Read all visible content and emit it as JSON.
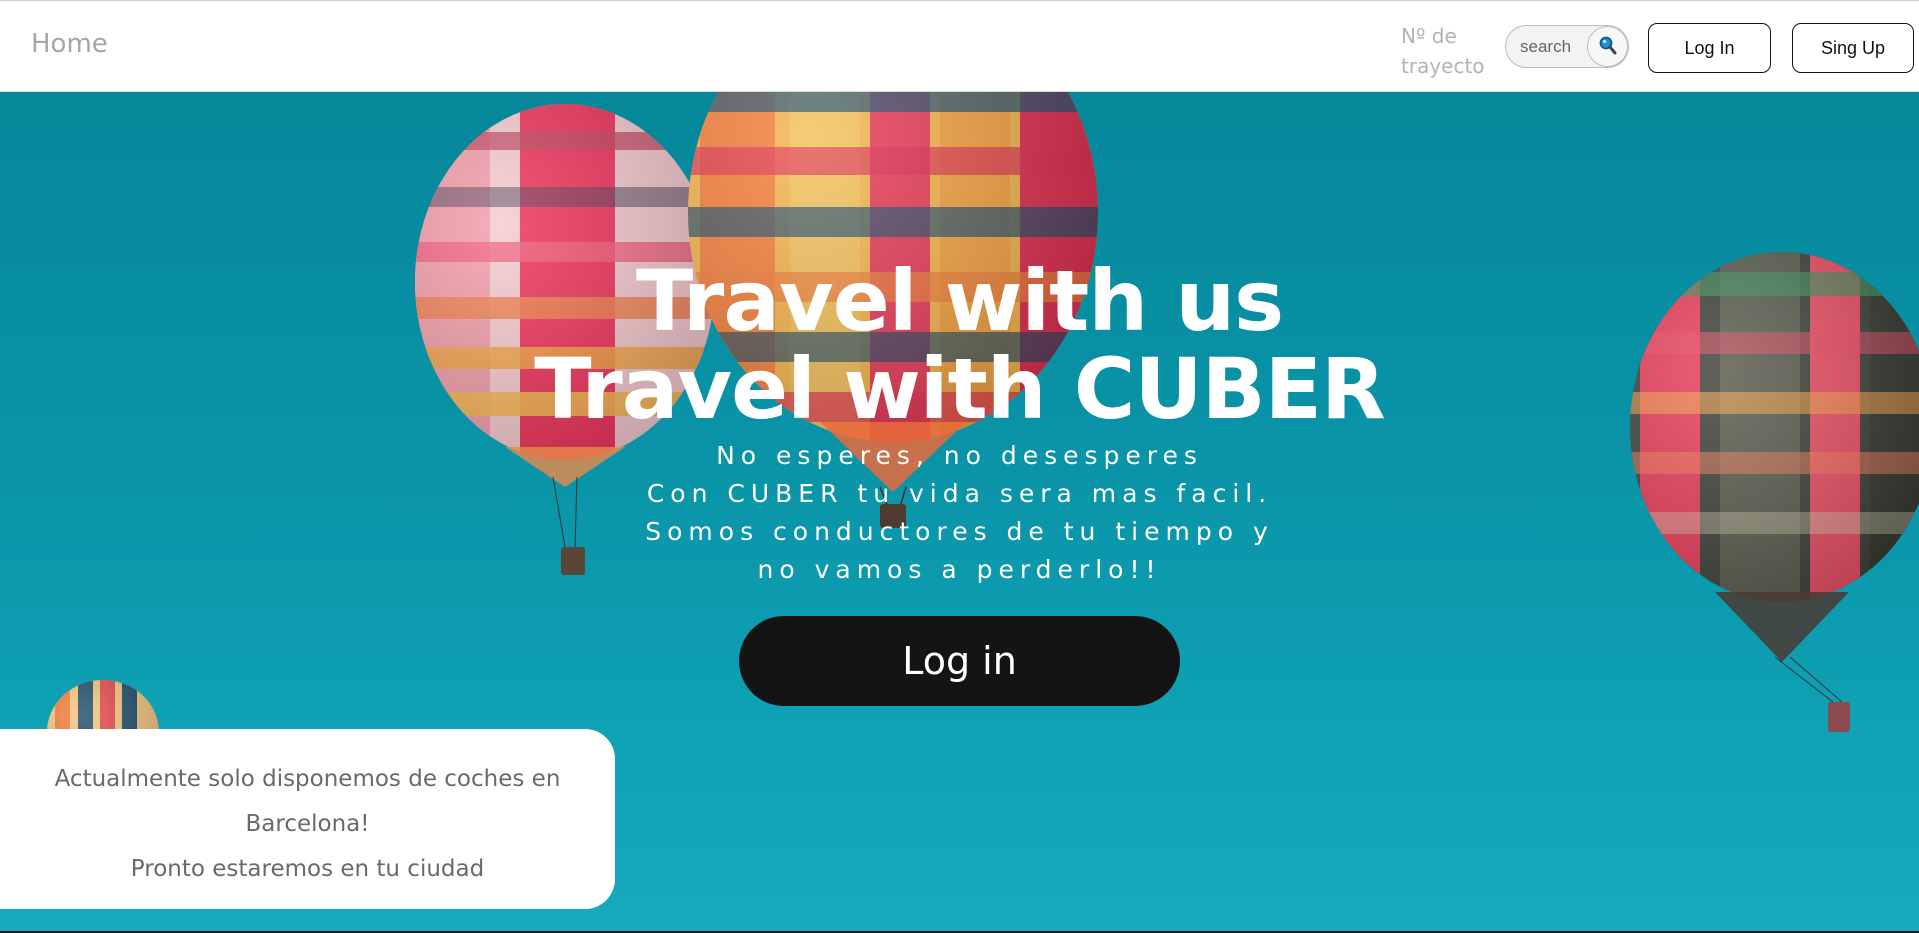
{
  "nav": {
    "home_label": "Home",
    "trip_label": "Nº de trayecto",
    "search": {
      "placeholder": "search"
    },
    "login_label": "Log In",
    "signup_label": "Sing Up"
  },
  "hero": {
    "title_line1": "Travel with us",
    "title_line2": "Travel with CUBER",
    "subtitle_lines": [
      "No esperes, no desesperes",
      "Con CUBER tu vida sera mas facil.",
      "Somos conductores de tu tiempo y",
      "no vamos a perderlo!!"
    ],
    "cta_label": "Log in",
    "background_image": "hot-air-balloons-over-turquoise-sky"
  },
  "notice": {
    "line1": "Actualmente solo disponemos de coches en",
    "line2": "Barcelona!",
    "line3": "Pronto estaremos en tu ciudad"
  },
  "colors": {
    "sky": "#0a94a8",
    "cta_background": "#141414",
    "nav_muted_text": "#a6a6a6"
  },
  "icons": {
    "search": "magnifier-icon"
  }
}
